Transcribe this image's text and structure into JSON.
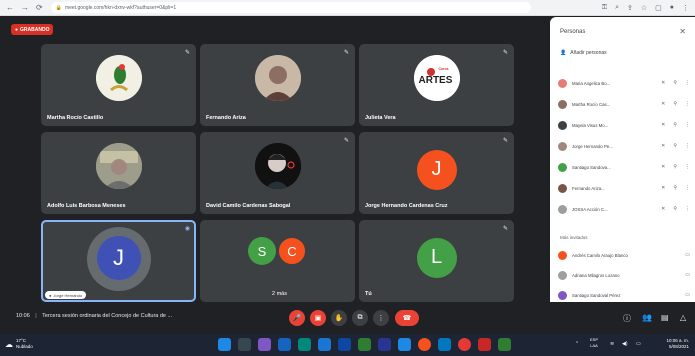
{
  "browser": {
    "url": "meet.google.com/hkn-dxnv-wkf?authuser=0&pli=1",
    "nav_icons": [
      "back-icon",
      "forward-icon",
      "reload-icon"
    ]
  },
  "meeting": {
    "recording_label": "GRABANDO",
    "time": "10:06",
    "separator": "|",
    "title": "Tercera sesión ordinaria del Concejo de Cultura de ...",
    "tiles": [
      {
        "name": "Martha Rocío Castillo",
        "avatar_type": "photo"
      },
      {
        "name": "Fernando Ariza",
        "avatar_type": "photo"
      },
      {
        "name": "Julieta Vera",
        "avatar_type": "logo",
        "logo_text": "ARTES",
        "logo_small": "Coros"
      },
      {
        "name": "Adolfo Luis Barbosa Meneses",
        "avatar_type": "photo"
      },
      {
        "name": "David Camilo Cardenas Sabogal",
        "avatar_type": "photo"
      },
      {
        "name": "Jorge Hernando Cardenas Cruz",
        "avatar_type": "letter",
        "letter": "J",
        "color": "#f4511e"
      },
      {
        "name": "Jorge Hernando",
        "avatar_type": "letter",
        "letter": "J",
        "color": "#3f51b5",
        "selected": true
      },
      {
        "name": "2 más",
        "avatar_type": "pair",
        "letters": [
          "S",
          "C"
        ],
        "colors": [
          "#43a047",
          "#f4511e"
        ]
      },
      {
        "name": "Tú",
        "avatar_type": "letter",
        "letter": "L",
        "color": "#43a047"
      }
    ]
  },
  "panel": {
    "title": "Personas",
    "add_label": "Añadir personas",
    "participants": [
      {
        "name": "Maria Angelica Bo...",
        "color": "#e67c73"
      },
      {
        "name": "Martha Rocío Cas...",
        "color": "#8d6e63"
      },
      {
        "name": "Mayela Visus Mo...",
        "color": "#3c4043"
      },
      {
        "name": "Jorge Hernando Pe...",
        "color": "#a1887f"
      },
      {
        "name": "Santiago Sandova...",
        "color": "#43a047"
      },
      {
        "name": "Fernando Ariza...",
        "color": "#795548"
      },
      {
        "name": "JOSSA Acción C...",
        "color": "#9e9e9e"
      }
    ],
    "section_label": "Más invitados",
    "guests": [
      {
        "name": "Andrés Camilo Araujo Blanco",
        "color": "#f4511e"
      },
      {
        "name": "Adriana Milagros Lozano",
        "color": "#9e9e9e"
      },
      {
        "name": "Santiago Sandoval Pérez",
        "color": "#7e57c2"
      }
    ]
  },
  "taskbar": {
    "weather_temp": "17°C",
    "weather_desc": "Nublado",
    "lang": "ESP",
    "lang2": "LAA",
    "time": "10:06 a. m.",
    "date": "5/08/2021"
  }
}
